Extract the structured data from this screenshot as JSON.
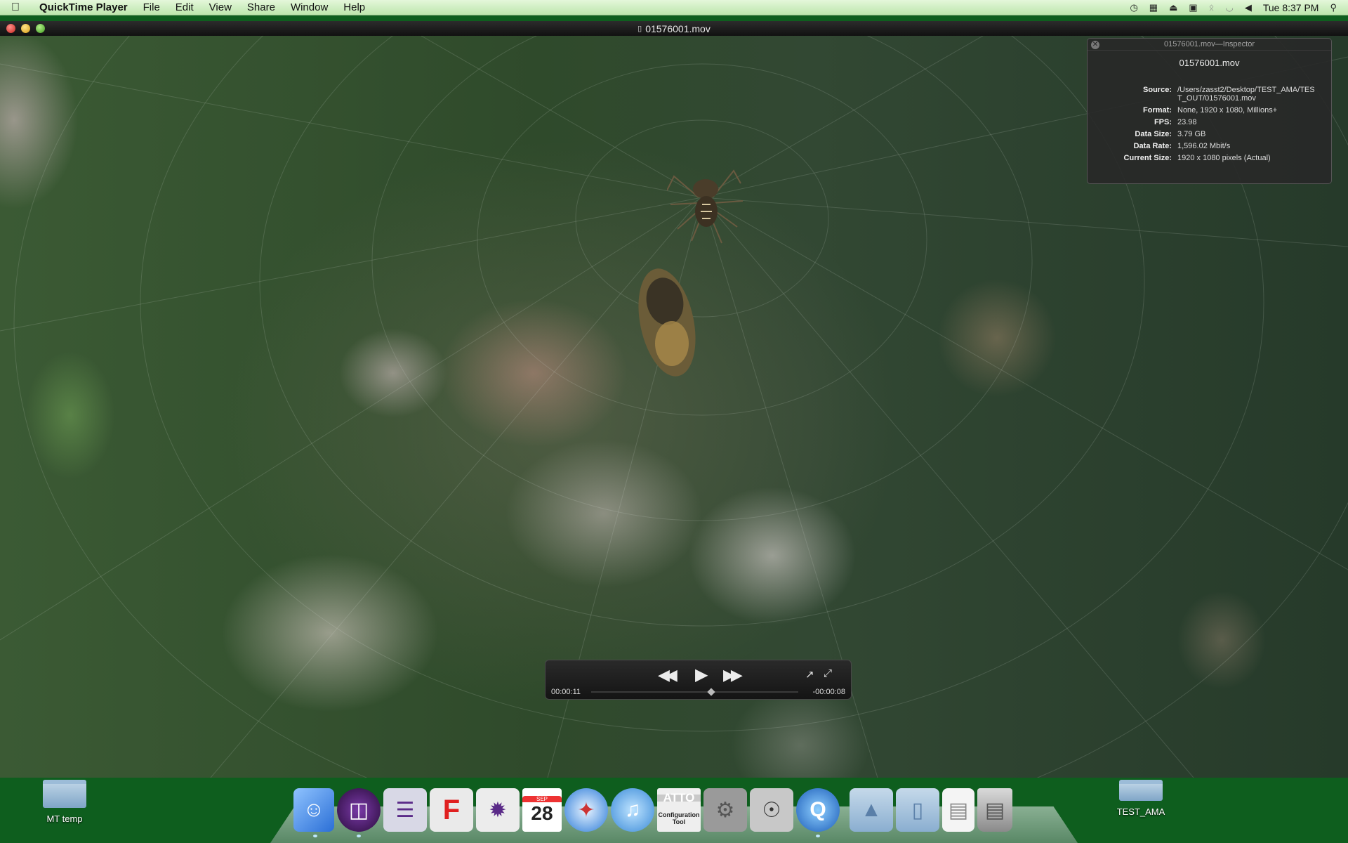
{
  "menubar": {
    "app_name": "QuickTime Player",
    "menus": [
      "File",
      "Edit",
      "View",
      "Share",
      "Window",
      "Help"
    ],
    "clock": "Tue 8:37 PM"
  },
  "window": {
    "title": "01576001.mov"
  },
  "inspector": {
    "title": "01576001.mov—Inspector",
    "file_name": "01576001.mov",
    "rows": [
      {
        "label": "Source:",
        "value": "/Users/zasst2/Desktop/TEST_AMA/TEST_OUT/01576001.mov"
      },
      {
        "label": "Format:",
        "value": "None, 1920 x 1080, Millions+"
      },
      {
        "label": "FPS:",
        "value": "23.98"
      },
      {
        "label": "Data Size:",
        "value": "3.79 GB"
      },
      {
        "label": "Data Rate:",
        "value": "1,596.02 Mbit/s"
      },
      {
        "label": "Current Size:",
        "value": "1920 x 1080 pixels (Actual)"
      }
    ]
  },
  "controller": {
    "elapsed": "00:00:11",
    "remaining": "-00:00:08",
    "progress": 0.58
  },
  "desktop": {
    "left_folder": "MT temp",
    "right_folder": "TEST_AMA"
  },
  "dock": {
    "calendar_month": "SEP",
    "calendar_day": "28",
    "atto_top": "ATTO",
    "atto_label": "Configuration Tool"
  }
}
